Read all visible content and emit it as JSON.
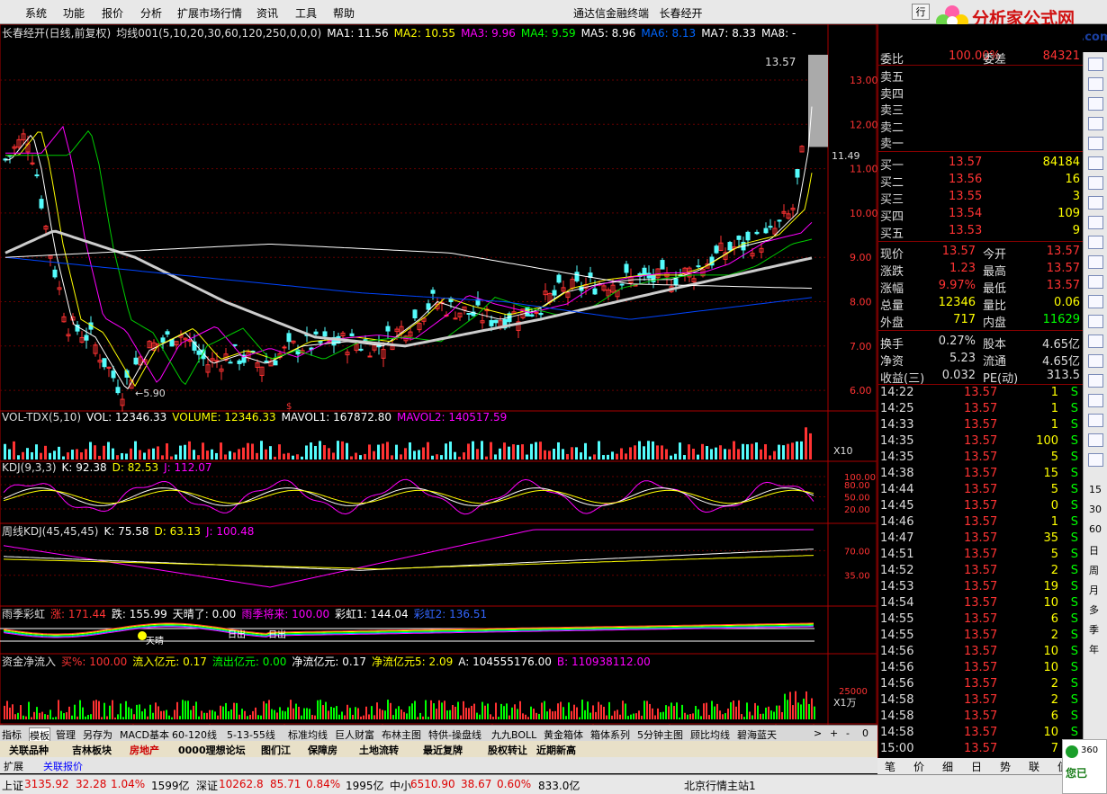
{
  "menu": {
    "items": [
      "系统",
      "功能",
      "报价",
      "分析",
      "扩展市场行情",
      "资讯",
      "工具",
      "帮助"
    ],
    "title": "通达信金融终端",
    "stock": "长春经开",
    "right_button": "行"
  },
  "logo": {
    "text": "分析家公式网",
    "url": "www.88gs.com"
  },
  "main_title": {
    "name": "长春经开(日线,前复权)",
    "ind": "均线001(5,10,20,30,60,120,250,0,0,0)",
    "ma": [
      {
        "label": "MA1: 11.56",
        "color": "#ffffff"
      },
      {
        "label": "MA2: 10.55",
        "color": "#ffff00"
      },
      {
        "label": "MA3: 9.96",
        "color": "#ff00ff"
      },
      {
        "label": "MA4: 9.59",
        "color": "#00ff00"
      },
      {
        "label": "MA5: 8.96",
        "color": "#ffffff"
      },
      {
        "label": "MA6: 8.13",
        "color": "#0066ff"
      },
      {
        "label": "MA7: 8.33",
        "color": "#ffffff"
      },
      {
        "label": "MA8: -",
        "color": "#ffffff"
      }
    ]
  },
  "price_axis": [
    "13.00",
    "12.00",
    "11.00",
    "10.00",
    "9.00",
    "8.00",
    "7.00",
    "6.00"
  ],
  "price_marks": {
    "high": "13.57",
    "low": "5.90",
    "recent": "11.49"
  },
  "vol_title": {
    "name": "VOL-TDX(5,10)",
    "vol": "VOL: 12346.33",
    "volume": "VOLUME: 12346.33",
    "mavol1": "MAVOL1: 167872.80",
    "mavol2": "MAVOL2: 140517.59",
    "unit": "X10"
  },
  "kdj_title": {
    "name": "KDJ(9,3,3)",
    "k": "K: 92.38",
    "d": "D: 82.53",
    "j": "J: 112.07"
  },
  "kdj_axis": [
    "100.00",
    "80.00",
    "50.00",
    "20.00"
  ],
  "wkdj_title": {
    "name": "周线KDJ(45,45,45)",
    "k": "K: 75.58",
    "d": "D: 63.13",
    "j": "J: 100.48"
  },
  "wkdj_axis": [
    "70.00",
    "35.00"
  ],
  "rain_title": {
    "name": "雨季彩虹",
    "zhang": "涨: 171.44",
    "die": "跌: 155.99",
    "tian": "天晴了: 0.00",
    "yuji": "雨季将来: 100.00",
    "caihong1": "彩虹1: 144.04",
    "caihong2": "彩虹2: 136.51"
  },
  "rain_marks": [
    "日出",
    "日出",
    "天晴"
  ],
  "flow_title": {
    "name": "资金净流入",
    "buy": "买%: 100.00",
    "in": "流入亿元: 0.17",
    "out": "流出亿元: 0.00",
    "net": "净流亿元: 0.17",
    "net5": "净流亿元5: 2.09",
    "a": "A: 104555176.00",
    "b": "B: 110938112.00"
  },
  "flow_axis": [
    "25000"
  ],
  "flow_unit": "X1万",
  "x_axis": [
    "2015年",
    "2",
    "3",
    "7",
    "8",
    "9",
    "10",
    "11",
    "12",
    "1"
  ],
  "x_right": "日线",
  "tabs1": [
    "指标",
    "模板",
    "管理",
    "另存为",
    "MACD基本",
    "60-120线",
    "5-13-55线",
    "标准均线",
    "巨人财富",
    "布林主图",
    "特供-操盘线",
    "九九BOLL",
    "黄金箱体",
    "箱体系列",
    "5分钟主图",
    "顾比均线",
    "碧海蓝天"
  ],
  "tabs2": [
    "关联品种",
    "吉林板块",
    "房地产",
    "0000理想论坛",
    "图们江",
    "保障房",
    "土地流转",
    "最近复牌",
    "股权转让",
    "近期新高"
  ],
  "tabs3": [
    "扩展",
    "关联报价"
  ],
  "orderbook": {
    "weibi_label": "委比",
    "weibi": "100.00%",
    "weicha_label": "委差",
    "weicha": "84321",
    "sells": [
      "卖五",
      "卖四",
      "卖三",
      "卖二",
      "卖一"
    ],
    "buys": [
      {
        "l": "买一",
        "p": "13.57",
        "v": "84184"
      },
      {
        "l": "买二",
        "p": "13.56",
        "v": "16"
      },
      {
        "l": "买三",
        "p": "13.55",
        "v": "3"
      },
      {
        "l": "买四",
        "p": "13.54",
        "v": "109"
      },
      {
        "l": "买五",
        "p": "13.53",
        "v": "9"
      }
    ]
  },
  "quote": [
    {
      "l": "现价",
      "v": "13.57",
      "l2": "今开",
      "v2": "13.57"
    },
    {
      "l": "涨跌",
      "v": "1.23",
      "l2": "最高",
      "v2": "13.57"
    },
    {
      "l": "涨幅",
      "v": "9.97%",
      "l2": "最低",
      "v2": "13.57"
    },
    {
      "l": "总量",
      "v": "12346",
      "l2": "量比",
      "v2": "0.06"
    },
    {
      "l": "外盘",
      "v": "717",
      "l2": "内盘",
      "v2": "11629"
    }
  ],
  "fund": [
    {
      "l": "换手",
      "v": "0.27%",
      "l2": "股本",
      "v2": "4.65亿"
    },
    {
      "l": "净资",
      "v": "5.23",
      "l2": "流通",
      "v2": "4.65亿"
    },
    {
      "l": "收益(三)",
      "v": "0.032",
      "l2": "PE(动)",
      "v2": "313.5"
    }
  ],
  "ticks": [
    [
      "14:22",
      "13.57",
      "1",
      "S"
    ],
    [
      "14:25",
      "13.57",
      "1",
      "S"
    ],
    [
      "14:33",
      "13.57",
      "1",
      "S"
    ],
    [
      "14:35",
      "13.57",
      "100",
      "S"
    ],
    [
      "14:35",
      "13.57",
      "5",
      "S"
    ],
    [
      "14:38",
      "13.57",
      "15",
      "S"
    ],
    [
      "14:44",
      "13.57",
      "5",
      "S"
    ],
    [
      "14:45",
      "13.57",
      "0",
      "S"
    ],
    [
      "14:46",
      "13.57",
      "1",
      "S"
    ],
    [
      "14:47",
      "13.57",
      "35",
      "S"
    ],
    [
      "14:51",
      "13.57",
      "5",
      "S"
    ],
    [
      "14:52",
      "13.57",
      "2",
      "S"
    ],
    [
      "14:53",
      "13.57",
      "19",
      "S"
    ],
    [
      "14:54",
      "13.57",
      "10",
      "S"
    ],
    [
      "14:55",
      "13.57",
      "6",
      "S"
    ],
    [
      "14:55",
      "13.57",
      "2",
      "S"
    ],
    [
      "14:56",
      "13.57",
      "10",
      "S"
    ],
    [
      "14:56",
      "13.57",
      "10",
      "S"
    ],
    [
      "14:56",
      "13.57",
      "2",
      "S"
    ],
    [
      "14:58",
      "13.57",
      "2",
      "S"
    ],
    [
      "14:58",
      "13.57",
      "6",
      "S"
    ],
    [
      "14:58",
      "13.57",
      "10",
      "S"
    ],
    [
      "15:00",
      "13.57",
      "7",
      "S"
    ]
  ],
  "rtabs": [
    "笔",
    "价",
    "细",
    "日",
    "势",
    "联",
    "值"
  ],
  "side": [
    "15",
    "30",
    "60",
    "日",
    "周",
    "月",
    "多",
    "季",
    "年"
  ],
  "status": {
    "sh_label": "上证",
    "sh": "3135.92",
    "sh_chg": "32.28",
    "sh_pct": "1.04%",
    "sh_amt": "1599亿",
    "sz_label": "深证",
    "sz": "10262.8",
    "sz_chg": "85.71",
    "sz_pct": "0.84%",
    "sz_amt": "1995亿",
    "zx_label": "中小",
    "zx": "6510.90",
    "zx_chg": "38.67",
    "zx_pct": "0.60%",
    "zx_amt": "833.0亿",
    "site": "北京行情主站1"
  },
  "toast": {
    "brand": "360",
    "text": "您已"
  },
  "colors": {
    "up": "#ff3232",
    "down": "#54fcfc",
    "white": "#ffffff",
    "yellow": "#ffff00",
    "magenta": "#ff00ff",
    "green": "#00ff00"
  }
}
